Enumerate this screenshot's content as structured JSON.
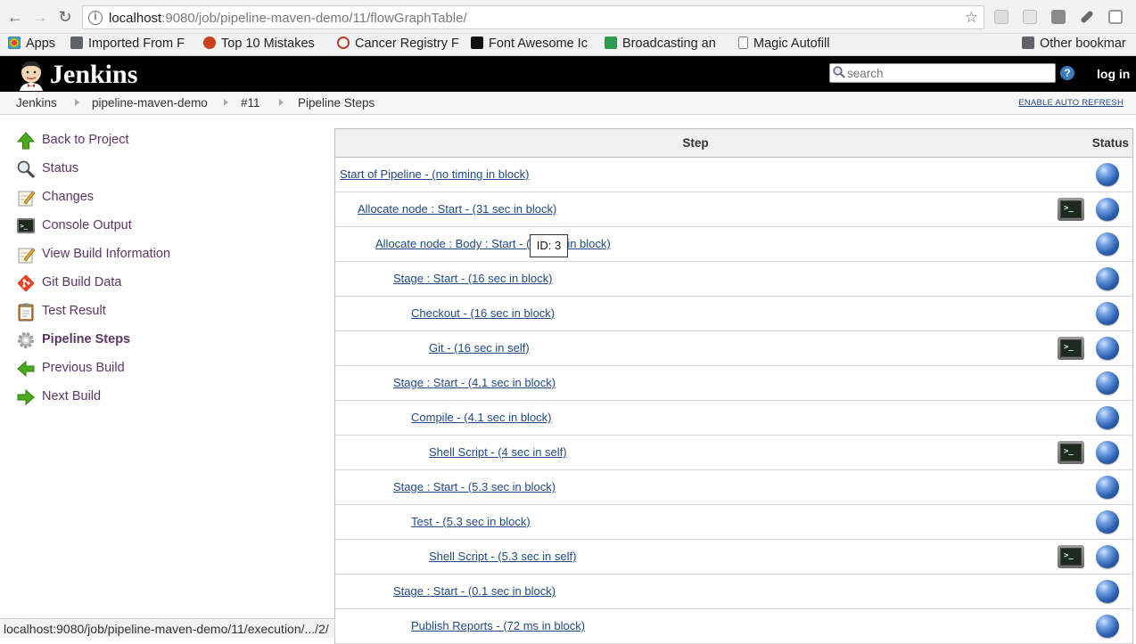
{
  "browser": {
    "url_host": "localhost",
    "url_path": ":9080/job/pipeline-maven-demo/11/flowGraphTable/",
    "bookmarks": [
      {
        "label": "Apps",
        "icon": "apps-grid-icon",
        "color": "#e2443a"
      },
      {
        "label": "Imported From F",
        "icon": "folder-icon",
        "color": "#5f6368"
      },
      {
        "label": "Top 10 Mistakes",
        "icon": "warning-circle-icon",
        "color": "#c9401f"
      },
      {
        "label": "Cancer Registry F",
        "icon": "registry-icon",
        "color": "#c0392b"
      },
      {
        "label": "Font Awesome Ic",
        "icon": "flag-icon",
        "color": "#111111"
      },
      {
        "label": "Broadcasting an",
        "icon": "m-logo-icon",
        "color": "#2a9d4a"
      },
      {
        "label": "Magic Autofill",
        "icon": "page-icon",
        "color": "#888888"
      },
      {
        "label": "Other bookmar",
        "icon": "folder-icon",
        "color": "#5f6368"
      }
    ]
  },
  "header": {
    "title": "Jenkins",
    "search_placeholder": "search",
    "help": "?",
    "login": "log in"
  },
  "breadcrumb": {
    "items": [
      "Jenkins",
      "pipeline-maven-demo",
      "#11",
      "Pipeline Steps"
    ],
    "auto_refresh": "ENABLE AUTO REFRESH"
  },
  "sidebar": {
    "items": [
      {
        "label": "Back to Project",
        "icon": "up-arrow-icon"
      },
      {
        "label": "Status",
        "icon": "magnifier-icon"
      },
      {
        "label": "Changes",
        "icon": "notepad-icon"
      },
      {
        "label": "Console Output",
        "icon": "terminal-icon"
      },
      {
        "label": "View Build Information",
        "icon": "notepad-icon"
      },
      {
        "label": "Git Build Data",
        "icon": "git-icon"
      },
      {
        "label": "Test Result",
        "icon": "clipboard-icon"
      },
      {
        "label": "Pipeline Steps",
        "icon": "gear-icon",
        "active": true
      },
      {
        "label": "Previous Build",
        "icon": "left-arrow-icon"
      },
      {
        "label": "Next Build",
        "icon": "right-arrow-icon"
      }
    ]
  },
  "table": {
    "headers": {
      "step": "Step",
      "status": "Status"
    },
    "rows": [
      {
        "text": "Start of Pipeline - (no timing in block)",
        "indent": 0,
        "console": false
      },
      {
        "text": "Allocate node : Start - (31 sec in block)",
        "indent": 1,
        "console": true
      },
      {
        "text": "Allocate node : Body : Start - (31 sec in block)",
        "indent": 2,
        "console": false
      },
      {
        "text": "Stage : Start - (16 sec in block)",
        "indent": 3,
        "console": false
      },
      {
        "text": "Checkout - (16 sec in block)",
        "indent": 4,
        "console": false
      },
      {
        "text": "Git - (16 sec in self)",
        "indent": 5,
        "console": true
      },
      {
        "text": "Stage : Start - (4.1 sec in block)",
        "indent": 3,
        "console": false
      },
      {
        "text": "Compile - (4.1 sec in block)",
        "indent": 4,
        "console": false
      },
      {
        "text": "Shell Script - (4 sec in self)",
        "indent": 5,
        "console": true
      },
      {
        "text": "Stage : Start - (5.3 sec in block)",
        "indent": 3,
        "console": false
      },
      {
        "text": "Test - (5.3 sec in block)",
        "indent": 4,
        "console": false
      },
      {
        "text": "Shell Script - (5.3 sec in self)",
        "indent": 5,
        "console": true
      },
      {
        "text": "Stage : Start - (0.1 sec in block)",
        "indent": 3,
        "console": false
      },
      {
        "text": "Publish Reports - (72 ms in block)",
        "indent": 4,
        "console": false
      }
    ],
    "console_glyph": ">_",
    "status_color": "#2c5fb0"
  },
  "tooltip": "ID: 3",
  "statusbar": "localhost:9080/job/pipeline-maven-demo/11/execution/.../2/"
}
